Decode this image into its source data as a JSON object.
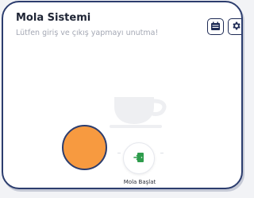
{
  "card": {
    "title": "Mola Sistemi",
    "subtitle": "Lütfen giriş ve çıkış yapmayı unutma!"
  },
  "toolbar": {
    "calendar_icon": "calendar-icon",
    "settings_icon": "gear-icon"
  },
  "illustration": {
    "cup_icon": "coffee-cup-icon"
  },
  "user": {
    "avatar_color": "#f79a40"
  },
  "action": {
    "start_label": "Mola Başlat",
    "start_icon": "exit-door-icon",
    "accent_color": "#2e9c4c"
  }
}
